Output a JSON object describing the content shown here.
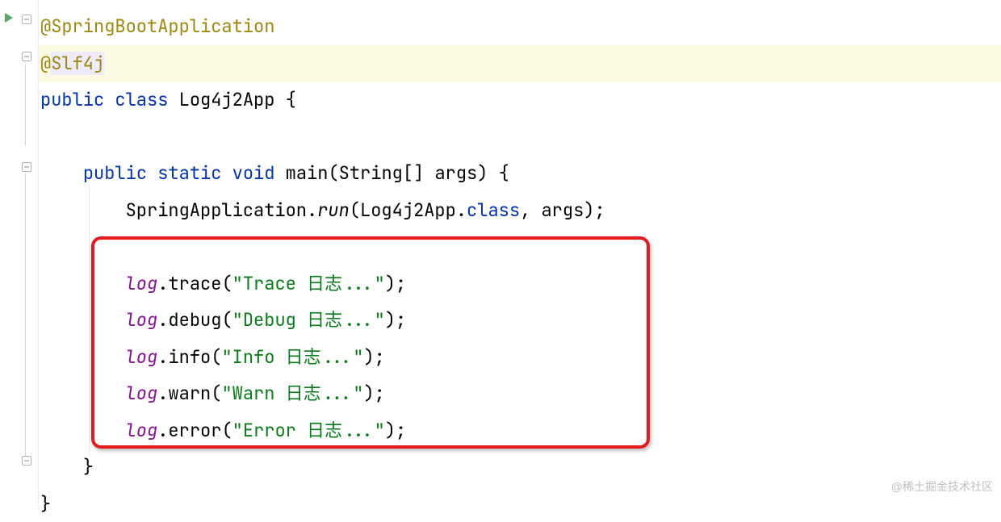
{
  "colors": {
    "keyword": "#0033b3",
    "annotation": "#9e880d",
    "string": "#067d17",
    "field": "#871094",
    "highlight_box": "#e31b1b"
  },
  "code": {
    "annotation1": "@SpringBootApplication",
    "annotation2_at": "@",
    "annotation2_name": "Slf4j",
    "class_decl": {
      "kw_public": "public",
      "kw_class": "class",
      "name": "Log4j2App",
      "brace": " {"
    },
    "main_decl": {
      "kw_public": "public",
      "kw_static": "static",
      "kw_void": "void",
      "name": "main",
      "params": "(String[] args) {"
    },
    "spring_run": {
      "cls": "SpringApplication",
      "mtd": "run",
      "arg_cls": "Log4j2App",
      "kw_class": "class",
      "tail": ", args);"
    },
    "logs": {
      "var": "log",
      "trace": {
        "mtd": "trace",
        "str": "\"Trace 日志...\""
      },
      "debug": {
        "mtd": "debug",
        "str": "\"Debug 日志...\""
      },
      "info": {
        "mtd": "info",
        "str": "\"Info 日志...\""
      },
      "warn": {
        "mtd": "warn",
        "str": "\"Warn 日志...\""
      },
      "error": {
        "mtd": "error",
        "str": "\"Error 日志...\""
      }
    },
    "close_brace": "}"
  },
  "watermark": "@稀土掘金技术社区"
}
